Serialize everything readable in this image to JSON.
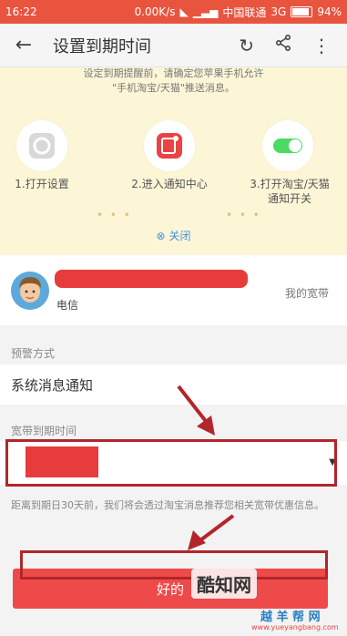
{
  "status_bar": {
    "time": "16:22",
    "speed": "0.00K/s",
    "carrier": "中国联通",
    "network": "3G",
    "battery": "94%"
  },
  "app_bar": {
    "title": "设置到期时间"
  },
  "banner": {
    "hint_line1": "设定到期提醒前，请确定您苹果手机允许",
    "hint_line2": "\"手机淘宝/天猫\"推送消息。",
    "step1": "1.打开设置",
    "step2": "2.进入通知中心",
    "step3_line1": "3.打开淘宝/天猫",
    "step3_line2": "通知开关",
    "close": "关闭"
  },
  "account": {
    "carrier": "电信",
    "link": "我的宽带"
  },
  "alert_method": {
    "label": "预警方式",
    "value": "系统消息通知"
  },
  "expiry": {
    "label": "宽带到期时间"
  },
  "description": "距离到期日30天前，我们将会透过淘宝消息推荐您相关宽带优惠信息。",
  "submit": {
    "label": "好的"
  },
  "watermark": {
    "text1": "酷知网",
    "text2": "越 羊 帮 网",
    "url": "www.yueyangbang.com"
  },
  "colors": {
    "accent": "#e9543f",
    "banner_bg": "#fcf6d7",
    "annotation": "#b2262b"
  }
}
